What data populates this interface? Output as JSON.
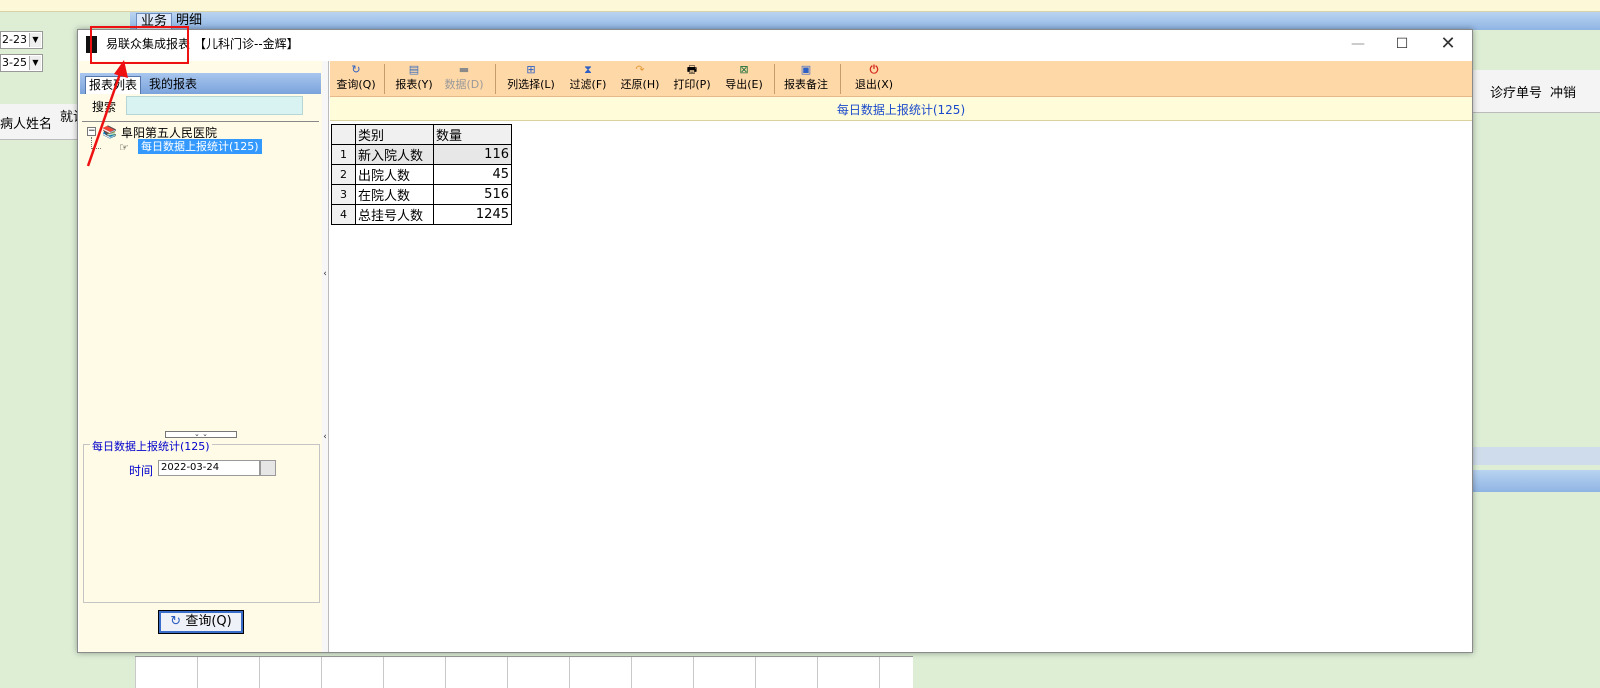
{
  "background_app": {
    "tabs": [
      "业务",
      "明细"
    ],
    "date_from": "2-23",
    "date_to": "3-25",
    "left_columns": [
      "病人姓名",
      "就诊"
    ],
    "right_columns": [
      "诊疗单号",
      "冲销"
    ]
  },
  "window": {
    "title": "易联众集成报表",
    "subtitle": "【儿科门诊--金辉】",
    "min_icon": "minimize-icon",
    "max_icon": "maximize-icon",
    "close_icon": "close-icon"
  },
  "left": {
    "tabs": [
      "报表列表",
      "我的报表"
    ],
    "search_label": "搜索",
    "search_value": "",
    "tree": {
      "root": "阜阳第五人民医院",
      "leaf": "每日数据上报统计(125)"
    },
    "params": {
      "title": "每日数据上报统计(125)",
      "time_label": "时间",
      "time_value": "2022-03-24"
    },
    "query_button": "查询(Q)"
  },
  "toolbar": {
    "query": "查询(Q)",
    "report": "报表(Y)",
    "data": "数据(D)",
    "columns": "列选择(L)",
    "filter": "过滤(F)",
    "restore": "还原(H)",
    "print": "打印(P)",
    "export": "导出(E)",
    "notes": "报表备注",
    "exit": "退出(X)"
  },
  "report": {
    "title": "每日数据上报统计(125)",
    "columns": [
      "类别",
      "数量"
    ],
    "rows": [
      {
        "n": "1",
        "category": "新入院人数",
        "count": "116"
      },
      {
        "n": "2",
        "category": "出院人数",
        "count": "45"
      },
      {
        "n": "3",
        "category": "在院人数",
        "count": "516"
      },
      {
        "n": "4",
        "category": "总挂号人数",
        "count": "1245"
      }
    ]
  },
  "colors": {
    "toolbar_bg": "#ffd8a8",
    "panel_bg": "#fffbe6",
    "selection": "#3399ff",
    "title_blue": "#1b4acb",
    "annotation_red": "#ee1111"
  }
}
